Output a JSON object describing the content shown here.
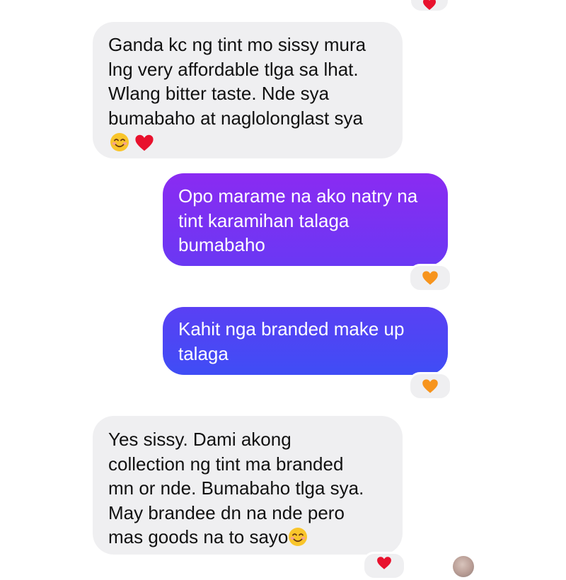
{
  "messages": [
    {
      "side": "incoming",
      "lines": [
        "Ganda kc ng tint mo sissy mura",
        "lng very affordable tlga sa lhat.",
        "Wlang bitter taste. Nde sya",
        "bumabaho at naglolonglast sya"
      ],
      "trailing_emojis": [
        "smiling-face-with-smiling-eyes",
        "red-heart"
      ]
    },
    {
      "side": "outgoing",
      "lines": [
        "Opo marame na ako natry na",
        "tint karamihan talaga",
        "bumabaho"
      ],
      "reaction": "orange-heart"
    },
    {
      "side": "outgoing",
      "lines": [
        "Kahit nga branded make up",
        "talaga"
      ],
      "reaction": "orange-heart"
    },
    {
      "side": "incoming",
      "lines": [
        "Yes sissy. Dami akong",
        "collection ng tint ma branded",
        "mn or nde. Bumabaho tlga sya.",
        "May brandee dn na nde pero",
        "mas goods na to sayo"
      ],
      "trailing_emojis": [
        "smiling-face-with-smiling-eyes"
      ]
    }
  ],
  "colors": {
    "incoming_bubble": "#efeff1",
    "outgoing_gradient_top": "#8a2bf2",
    "outgoing_gradient_bottom": "#3f4df5",
    "orange_heart": "#f7941d",
    "red_heart": "#e8112d",
    "smile_face": "#f9c52b"
  }
}
